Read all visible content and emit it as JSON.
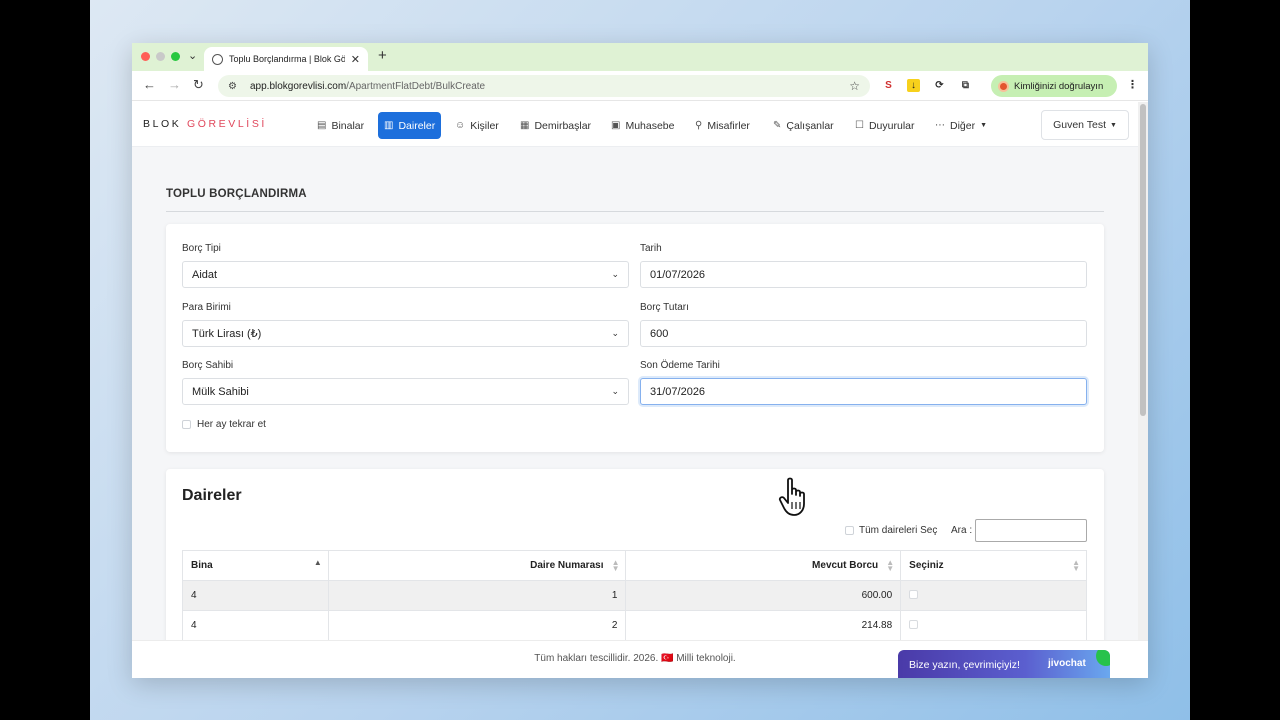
{
  "browser": {
    "tab_title": "Toplu Borçlandırma | Blok Gör",
    "url_host": "app.blokgorevlisi.com",
    "url_path": "/ApartmentFlatDebt/BulkCreate",
    "verify_label": "Kimliğinizi doğrulayın"
  },
  "site": {
    "logo_main": "BLOK ",
    "logo_accent": "GÖREVLİSİ",
    "nav": [
      {
        "label": "Binalar",
        "icon": "building-icon"
      },
      {
        "label": "Daireler",
        "icon": "apartment-icon",
        "active": true
      },
      {
        "label": "Kişiler",
        "icon": "person-icon"
      },
      {
        "label": "Demirbaşlar",
        "icon": "table-icon"
      },
      {
        "label": "Muhasebe",
        "icon": "money-icon"
      },
      {
        "label": "Misafirler",
        "icon": "walking-icon"
      },
      {
        "label": "Çalışanlar",
        "icon": "worker-icon"
      },
      {
        "label": "Duyurular",
        "icon": "message-icon"
      },
      {
        "label": "Diğer",
        "icon": "dots-icon"
      }
    ],
    "user_label": "Guven Test"
  },
  "page": {
    "title": "TOPLU BORÇLANDIRMA",
    "form": {
      "borc_tipi": {
        "label": "Borç Tipi",
        "value": "Aidat"
      },
      "tarih": {
        "label": "Tarih",
        "value": "01/07/2026"
      },
      "para_birimi": {
        "label": "Para Birimi",
        "value": "Türk Lirası (₺)"
      },
      "borc_tutari": {
        "label": "Borç Tutarı",
        "value": "600"
      },
      "borc_sahibi": {
        "label": "Borç Sahibi",
        "value": "Mülk Sahibi"
      },
      "son_odeme": {
        "label": "Son Ödeme Tarihi",
        "value": "31/07/2026"
      },
      "repeat_label": "Her ay tekrar et"
    },
    "daireler": {
      "title": "Daireler",
      "select_all_label": "Tüm daireleri Seç",
      "search_label": "Ara :",
      "columns": [
        "Bina",
        "Daire Numarası",
        "Mevcut Borcu",
        "Seçiniz"
      ],
      "rows": [
        {
          "bina": "4",
          "daire": "1",
          "borc": "600.00"
        },
        {
          "bina": "4",
          "daire": "2",
          "borc": "214.88"
        }
      ]
    }
  },
  "footer": {
    "text": "Tüm hakları tescillidir. 2026. 🇹🇷 Milli teknoloji.",
    "chat_text": "Bize yazın, çevrimiçiyiz!",
    "chat_brand": "jivochat"
  },
  "colors": {
    "accent": "#1d6fdc",
    "logo_accent": "#e0475b",
    "tab_bar": "#dff2d4"
  }
}
